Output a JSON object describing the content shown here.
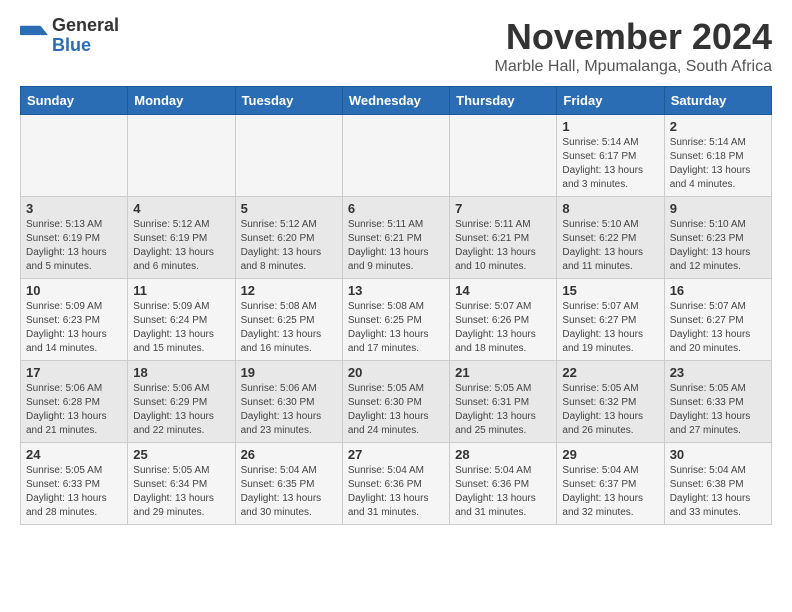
{
  "header": {
    "logo_general": "General",
    "logo_blue": "Blue",
    "month": "November 2024",
    "location": "Marble Hall, Mpumalanga, South Africa"
  },
  "days_of_week": [
    "Sunday",
    "Monday",
    "Tuesday",
    "Wednesday",
    "Thursday",
    "Friday",
    "Saturday"
  ],
  "weeks": [
    [
      {
        "day": "",
        "info": ""
      },
      {
        "day": "",
        "info": ""
      },
      {
        "day": "",
        "info": ""
      },
      {
        "day": "",
        "info": ""
      },
      {
        "day": "",
        "info": ""
      },
      {
        "day": "1",
        "info": "Sunrise: 5:14 AM\nSunset: 6:17 PM\nDaylight: 13 hours\nand 3 minutes."
      },
      {
        "day": "2",
        "info": "Sunrise: 5:14 AM\nSunset: 6:18 PM\nDaylight: 13 hours\nand 4 minutes."
      }
    ],
    [
      {
        "day": "3",
        "info": "Sunrise: 5:13 AM\nSunset: 6:19 PM\nDaylight: 13 hours\nand 5 minutes."
      },
      {
        "day": "4",
        "info": "Sunrise: 5:12 AM\nSunset: 6:19 PM\nDaylight: 13 hours\nand 6 minutes."
      },
      {
        "day": "5",
        "info": "Sunrise: 5:12 AM\nSunset: 6:20 PM\nDaylight: 13 hours\nand 8 minutes."
      },
      {
        "day": "6",
        "info": "Sunrise: 5:11 AM\nSunset: 6:21 PM\nDaylight: 13 hours\nand 9 minutes."
      },
      {
        "day": "7",
        "info": "Sunrise: 5:11 AM\nSunset: 6:21 PM\nDaylight: 13 hours\nand 10 minutes."
      },
      {
        "day": "8",
        "info": "Sunrise: 5:10 AM\nSunset: 6:22 PM\nDaylight: 13 hours\nand 11 minutes."
      },
      {
        "day": "9",
        "info": "Sunrise: 5:10 AM\nSunset: 6:23 PM\nDaylight: 13 hours\nand 12 minutes."
      }
    ],
    [
      {
        "day": "10",
        "info": "Sunrise: 5:09 AM\nSunset: 6:23 PM\nDaylight: 13 hours\nand 14 minutes."
      },
      {
        "day": "11",
        "info": "Sunrise: 5:09 AM\nSunset: 6:24 PM\nDaylight: 13 hours\nand 15 minutes."
      },
      {
        "day": "12",
        "info": "Sunrise: 5:08 AM\nSunset: 6:25 PM\nDaylight: 13 hours\nand 16 minutes."
      },
      {
        "day": "13",
        "info": "Sunrise: 5:08 AM\nSunset: 6:25 PM\nDaylight: 13 hours\nand 17 minutes."
      },
      {
        "day": "14",
        "info": "Sunrise: 5:07 AM\nSunset: 6:26 PM\nDaylight: 13 hours\nand 18 minutes."
      },
      {
        "day": "15",
        "info": "Sunrise: 5:07 AM\nSunset: 6:27 PM\nDaylight: 13 hours\nand 19 minutes."
      },
      {
        "day": "16",
        "info": "Sunrise: 5:07 AM\nSunset: 6:27 PM\nDaylight: 13 hours\nand 20 minutes."
      }
    ],
    [
      {
        "day": "17",
        "info": "Sunrise: 5:06 AM\nSunset: 6:28 PM\nDaylight: 13 hours\nand 21 minutes."
      },
      {
        "day": "18",
        "info": "Sunrise: 5:06 AM\nSunset: 6:29 PM\nDaylight: 13 hours\nand 22 minutes."
      },
      {
        "day": "19",
        "info": "Sunrise: 5:06 AM\nSunset: 6:30 PM\nDaylight: 13 hours\nand 23 minutes."
      },
      {
        "day": "20",
        "info": "Sunrise: 5:05 AM\nSunset: 6:30 PM\nDaylight: 13 hours\nand 24 minutes."
      },
      {
        "day": "21",
        "info": "Sunrise: 5:05 AM\nSunset: 6:31 PM\nDaylight: 13 hours\nand 25 minutes."
      },
      {
        "day": "22",
        "info": "Sunrise: 5:05 AM\nSunset: 6:32 PM\nDaylight: 13 hours\nand 26 minutes."
      },
      {
        "day": "23",
        "info": "Sunrise: 5:05 AM\nSunset: 6:33 PM\nDaylight: 13 hours\nand 27 minutes."
      }
    ],
    [
      {
        "day": "24",
        "info": "Sunrise: 5:05 AM\nSunset: 6:33 PM\nDaylight: 13 hours\nand 28 minutes."
      },
      {
        "day": "25",
        "info": "Sunrise: 5:05 AM\nSunset: 6:34 PM\nDaylight: 13 hours\nand 29 minutes."
      },
      {
        "day": "26",
        "info": "Sunrise: 5:04 AM\nSunset: 6:35 PM\nDaylight: 13 hours\nand 30 minutes."
      },
      {
        "day": "27",
        "info": "Sunrise: 5:04 AM\nSunset: 6:36 PM\nDaylight: 13 hours\nand 31 minutes."
      },
      {
        "day": "28",
        "info": "Sunrise: 5:04 AM\nSunset: 6:36 PM\nDaylight: 13 hours\nand 31 minutes."
      },
      {
        "day": "29",
        "info": "Sunrise: 5:04 AM\nSunset: 6:37 PM\nDaylight: 13 hours\nand 32 minutes."
      },
      {
        "day": "30",
        "info": "Sunrise: 5:04 AM\nSunset: 6:38 PM\nDaylight: 13 hours\nand 33 minutes."
      }
    ]
  ]
}
